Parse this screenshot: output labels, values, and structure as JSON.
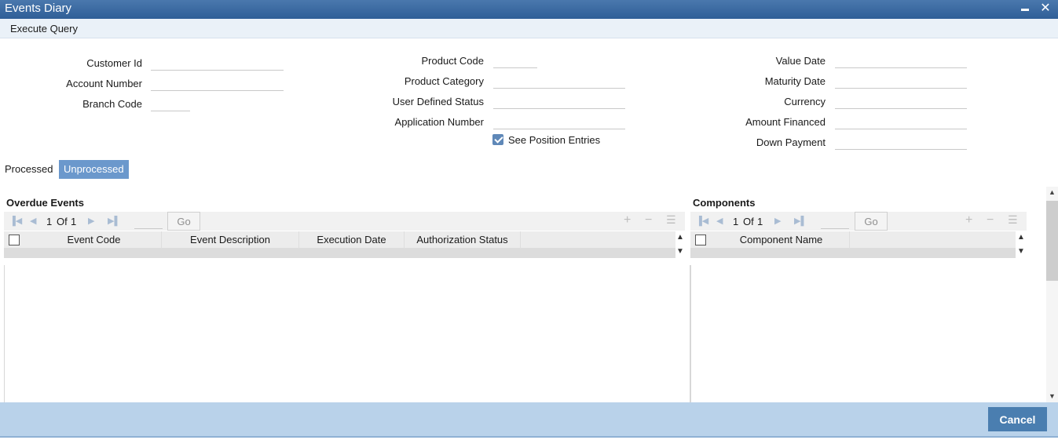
{
  "window": {
    "title": "Events Diary",
    "minimize": "",
    "close": "✕"
  },
  "menu": {
    "execute_query": "Execute Query"
  },
  "form": {
    "customer_id": {
      "label": "Customer Id",
      "value": ""
    },
    "account_number": {
      "label": "Account Number",
      "value": ""
    },
    "branch_code": {
      "label": "Branch Code",
      "value": ""
    },
    "product_code": {
      "label": "Product Code",
      "value": ""
    },
    "product_category": {
      "label": "Product Category",
      "value": ""
    },
    "user_defined_status": {
      "label": "User Defined Status",
      "value": ""
    },
    "application_number": {
      "label": "Application Number",
      "value": ""
    },
    "see_position_entries": {
      "label": "See Position Entries",
      "checked": true
    },
    "value_date": {
      "label": "Value Date",
      "value": ""
    },
    "maturity_date": {
      "label": "Maturity Date",
      "value": ""
    },
    "currency": {
      "label": "Currency",
      "value": ""
    },
    "amount_financed": {
      "label": "Amount Financed",
      "value": ""
    },
    "down_payment": {
      "label": "Down Payment",
      "value": ""
    }
  },
  "tabs": [
    {
      "label": "Processed",
      "active": false
    },
    {
      "label": "Unprocessed",
      "active": true
    }
  ],
  "overdue_events": {
    "title": "Overdue Events",
    "pager": {
      "current": "1",
      "of_label": "Of",
      "total": "1",
      "go_label": "Go"
    },
    "columns": [
      "Event Code",
      "Event Description",
      "Execution Date",
      "Authorization Status"
    ]
  },
  "components": {
    "title": "Components",
    "pager": {
      "current": "1",
      "of_label": "Of",
      "total": "1",
      "go_label": "Go"
    },
    "columns": [
      "Component Name"
    ]
  },
  "footer": {
    "cancel_label": "Cancel"
  },
  "colors": {
    "title_bar": "#2f5e97",
    "accent": "#6b98cc",
    "footer": "#b9d2ea",
    "button": "#4a7eb0"
  }
}
